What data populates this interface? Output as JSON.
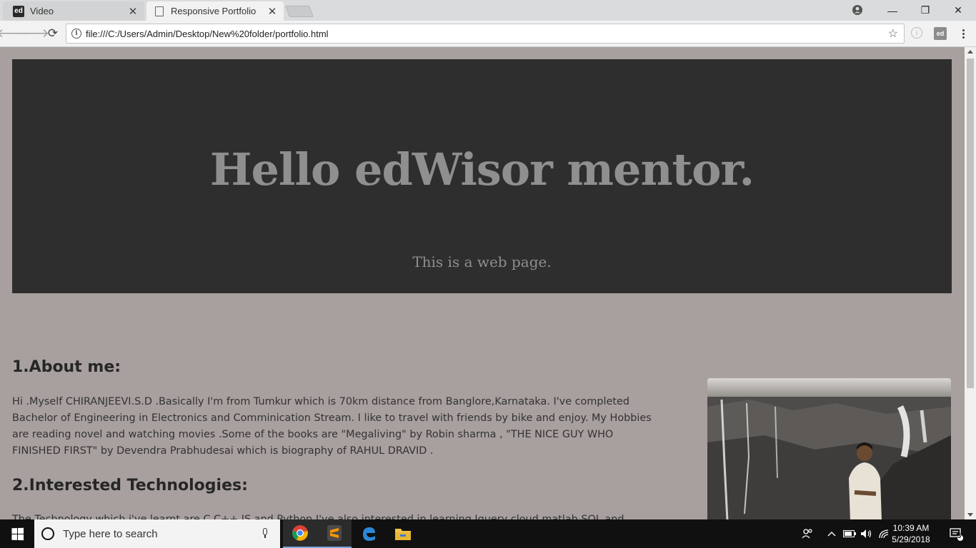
{
  "browser": {
    "tabs": [
      {
        "label": "Video",
        "favicon": "ed",
        "active": false
      },
      {
        "label": "Responsive Portfolio",
        "favicon": "page-icon",
        "active": true
      }
    ],
    "close_glyph": "✕",
    "window_controls": {
      "minimize": "—",
      "restore": "❐",
      "close": "✕"
    },
    "address": "file:///C:/Users/Admin/Desktop/New%20folder/portfolio.html",
    "ext_label": "ed"
  },
  "page": {
    "hero": {
      "title": "Hello edWisor mentor.",
      "subtitle": "This is a web page."
    },
    "about": {
      "heading": "1.About me:",
      "text": "Hi .Myself CHIRANJEEVI.S.D .Basically I'm from Tumkur which is 70km distance from Banglore,Karnataka. I've completed Bachelor of Engineering in Electronics and Comminication Stream. I like to travel with friends by bike and enjoy. My Hobbies are reading novel and watching movies .Some of the books are \"Megaliving\" by Robin sharma , \"THE NICE GUY WHO FINISHED FIRST\" by Devendra Prabhudesai which is biography of RAHUL DRAVID ."
    },
    "tech": {
      "heading": "2.Interested Technologies:",
      "text": "The Technology which i've learnt are C,C++,JS and Python.I've also interested in learning Jquery,cloud,matlab,SQL and"
    },
    "photo_alt": "person sitting on rocks near waterfall"
  },
  "taskbar": {
    "search_placeholder": "Type here to search",
    "apps": [
      "chrome-icon",
      "sublime-text-icon",
      "edge-icon",
      "file-explorer-icon"
    ],
    "clock_time": "10:39 AM",
    "clock_date": "5/29/2018",
    "notification_count": "5"
  }
}
